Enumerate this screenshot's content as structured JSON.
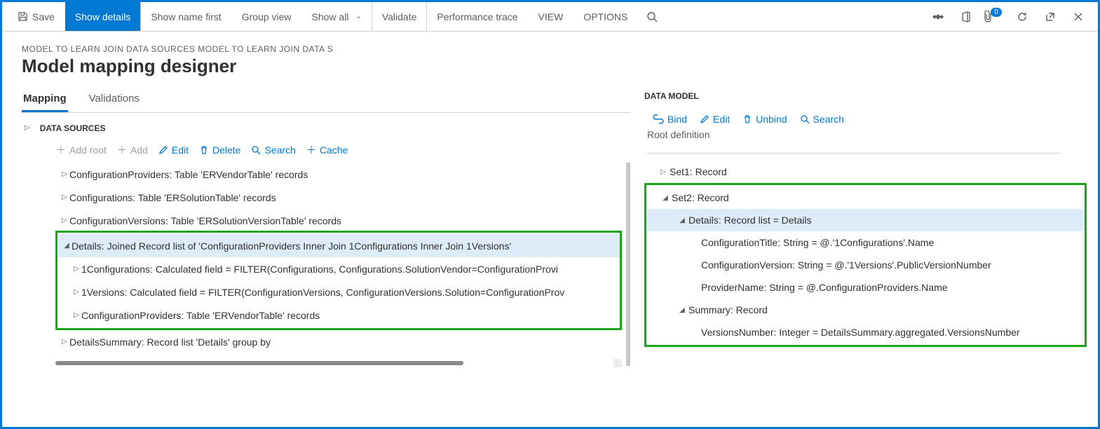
{
  "cmdbar": {
    "save": "Save",
    "show_details": "Show details",
    "show_name_first": "Show name first",
    "group_view": "Group view",
    "show_all": "Show all",
    "validate": "Validate",
    "perf_trace": "Performance trace",
    "view": "VIEW",
    "options": "OPTIONS",
    "badge_count": "0"
  },
  "heading": {
    "breadcrumb": "MODEL TO LEARN JOIN DATA SOURCES MODEL TO LEARN JOIN DATA S",
    "title": "Model mapping designer"
  },
  "tabs": {
    "mapping": "Mapping",
    "validations": "Validations"
  },
  "ds": {
    "header": "DATA SOURCES",
    "toolbar": {
      "add_root": "Add root",
      "add": "Add",
      "edit": "Edit",
      "delete": "Delete",
      "search": "Search",
      "cache": "Cache"
    },
    "nodes": {
      "n0": "ConfigurationProviders: Table 'ERVendorTable' records",
      "n1": "Configurations: Table 'ERSolutionTable' records",
      "n2": "ConfigurationVersions: Table 'ERSolutionVersionTable' records",
      "n3": "Details: Joined Record list of 'ConfigurationProviders Inner Join 1Configurations Inner Join 1Versions'",
      "n4": "1Configurations: Calculated field = FILTER(Configurations, Configurations.SolutionVendor=ConfigurationProvi",
      "n5": "1Versions: Calculated field = FILTER(ConfigurationVersions, ConfigurationVersions.Solution=ConfigurationProv",
      "n6": "ConfigurationProviders: Table 'ERVendorTable' records",
      "n7": "DetailsSummary: Record list 'Details' group by"
    }
  },
  "dm": {
    "header": "DATA MODEL",
    "toolbar": {
      "bind": "Bind",
      "edit": "Edit",
      "unbind": "Unbind",
      "search": "Search"
    },
    "rootdef": "Root definition",
    "nodes": {
      "m0": "Set1: Record",
      "m1": "Set2: Record",
      "m2": "Details: Record list = Details",
      "m3": "ConfigurationTitle: String = @.'1Configurations'.Name",
      "m4": "ConfigurationVersion: String = @.'1Versions'.PublicVersionNumber",
      "m5": "ProviderName: String = @.ConfigurationProviders.Name",
      "m6": "Summary: Record",
      "m7": "VersionsNumber: Integer = DetailsSummary.aggregated.VersionsNumber"
    }
  }
}
